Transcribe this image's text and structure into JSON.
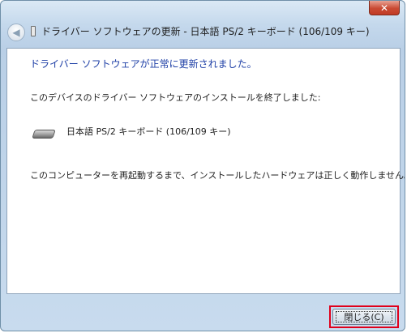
{
  "window": {
    "title": "ドライバー ソフトウェアの更新 - 日本語 PS/2 キーボード (106/109 キー)",
    "close_glyph": "✕"
  },
  "nav": {
    "back_glyph": "◀"
  },
  "content": {
    "heading": "ドライバー ソフトウェアが正常に更新されました。",
    "message1": "このデバイスのドライバー ソフトウェアのインストールを終了しました:",
    "device_name": "日本語 PS/2 キーボード (106/109 キー)",
    "message2": "このコンピューターを再起動するまで、インストールしたハードウェアは正しく動作しません。"
  },
  "footer": {
    "close_label": "閉じる(C)"
  },
  "colors": {
    "heading": "#1e3fa6",
    "highlight": "#e0001b"
  }
}
